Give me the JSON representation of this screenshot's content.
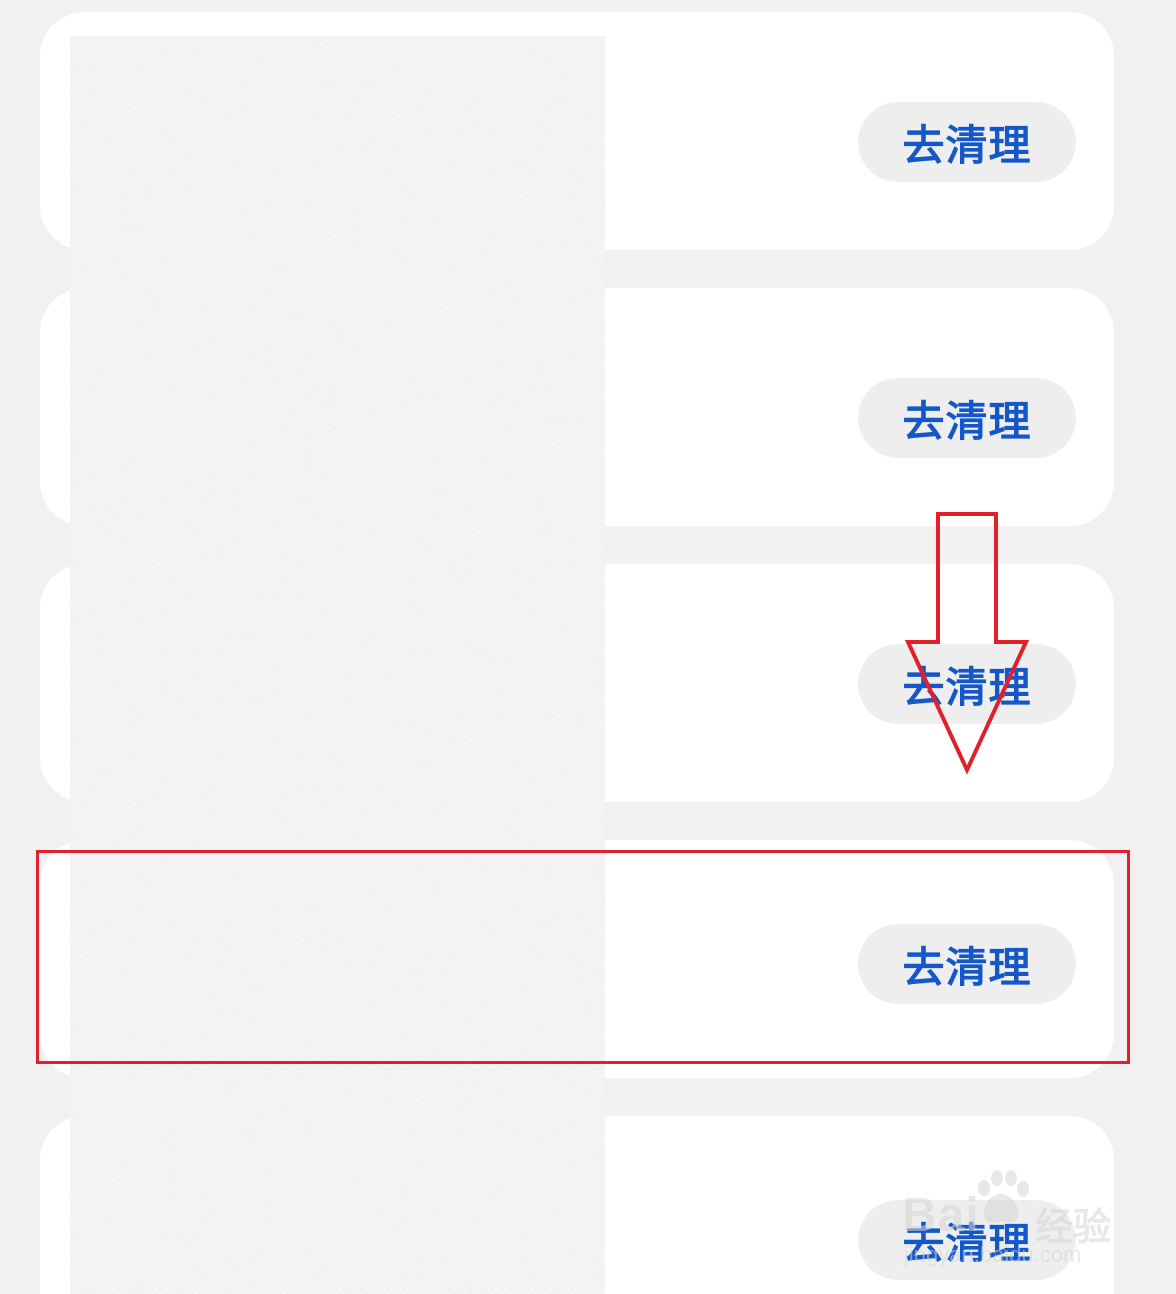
{
  "list": {
    "items": [
      {
        "button_label": "去清理"
      },
      {
        "button_label": "去清理"
      },
      {
        "button_label": "去清理"
      },
      {
        "button_label": "去清理"
      },
      {
        "button_label": "去清理"
      }
    ]
  },
  "annotations": {
    "highlight_color": "#e0202a",
    "arrow_color": "#e0202a",
    "arrow_icon": "down-arrow-icon",
    "highlighted_item_index": 3
  },
  "watermark": {
    "brand": "Bai",
    "brand_cn": "经验",
    "url": "jingyan.baidu.com"
  },
  "colors": {
    "background": "#f1f1f1",
    "card": "#ffffff",
    "button_bg": "#eeeeee",
    "button_text": "#1457c8"
  }
}
